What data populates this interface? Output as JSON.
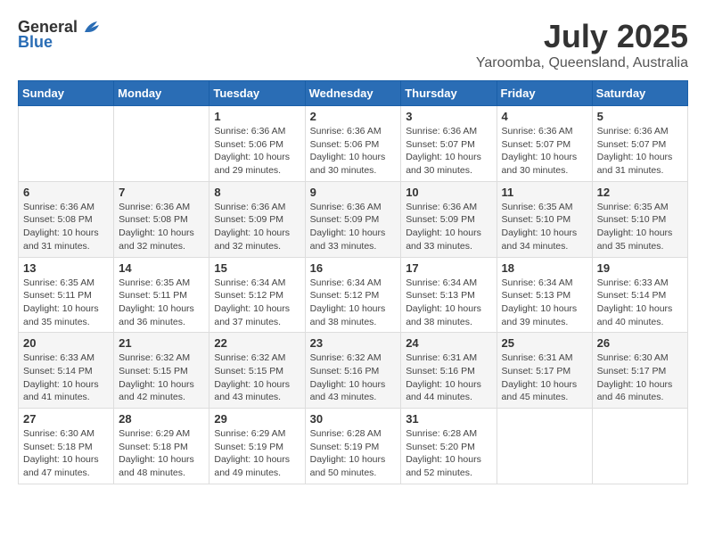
{
  "header": {
    "logo_general": "General",
    "logo_blue": "Blue",
    "month": "July 2025",
    "location": "Yaroomba, Queensland, Australia"
  },
  "calendar": {
    "days_of_week": [
      "Sunday",
      "Monday",
      "Tuesday",
      "Wednesday",
      "Thursday",
      "Friday",
      "Saturday"
    ],
    "weeks": [
      [
        {
          "day": "",
          "info": ""
        },
        {
          "day": "",
          "info": ""
        },
        {
          "day": "1",
          "info": "Sunrise: 6:36 AM\nSunset: 5:06 PM\nDaylight: 10 hours\nand 29 minutes."
        },
        {
          "day": "2",
          "info": "Sunrise: 6:36 AM\nSunset: 5:06 PM\nDaylight: 10 hours\nand 30 minutes."
        },
        {
          "day": "3",
          "info": "Sunrise: 6:36 AM\nSunset: 5:07 PM\nDaylight: 10 hours\nand 30 minutes."
        },
        {
          "day": "4",
          "info": "Sunrise: 6:36 AM\nSunset: 5:07 PM\nDaylight: 10 hours\nand 30 minutes."
        },
        {
          "day": "5",
          "info": "Sunrise: 6:36 AM\nSunset: 5:07 PM\nDaylight: 10 hours\nand 31 minutes."
        }
      ],
      [
        {
          "day": "6",
          "info": "Sunrise: 6:36 AM\nSunset: 5:08 PM\nDaylight: 10 hours\nand 31 minutes."
        },
        {
          "day": "7",
          "info": "Sunrise: 6:36 AM\nSunset: 5:08 PM\nDaylight: 10 hours\nand 32 minutes."
        },
        {
          "day": "8",
          "info": "Sunrise: 6:36 AM\nSunset: 5:09 PM\nDaylight: 10 hours\nand 32 minutes."
        },
        {
          "day": "9",
          "info": "Sunrise: 6:36 AM\nSunset: 5:09 PM\nDaylight: 10 hours\nand 33 minutes."
        },
        {
          "day": "10",
          "info": "Sunrise: 6:36 AM\nSunset: 5:09 PM\nDaylight: 10 hours\nand 33 minutes."
        },
        {
          "day": "11",
          "info": "Sunrise: 6:35 AM\nSunset: 5:10 PM\nDaylight: 10 hours\nand 34 minutes."
        },
        {
          "day": "12",
          "info": "Sunrise: 6:35 AM\nSunset: 5:10 PM\nDaylight: 10 hours\nand 35 minutes."
        }
      ],
      [
        {
          "day": "13",
          "info": "Sunrise: 6:35 AM\nSunset: 5:11 PM\nDaylight: 10 hours\nand 35 minutes."
        },
        {
          "day": "14",
          "info": "Sunrise: 6:35 AM\nSunset: 5:11 PM\nDaylight: 10 hours\nand 36 minutes."
        },
        {
          "day": "15",
          "info": "Sunrise: 6:34 AM\nSunset: 5:12 PM\nDaylight: 10 hours\nand 37 minutes."
        },
        {
          "day": "16",
          "info": "Sunrise: 6:34 AM\nSunset: 5:12 PM\nDaylight: 10 hours\nand 38 minutes."
        },
        {
          "day": "17",
          "info": "Sunrise: 6:34 AM\nSunset: 5:13 PM\nDaylight: 10 hours\nand 38 minutes."
        },
        {
          "day": "18",
          "info": "Sunrise: 6:34 AM\nSunset: 5:13 PM\nDaylight: 10 hours\nand 39 minutes."
        },
        {
          "day": "19",
          "info": "Sunrise: 6:33 AM\nSunset: 5:14 PM\nDaylight: 10 hours\nand 40 minutes."
        }
      ],
      [
        {
          "day": "20",
          "info": "Sunrise: 6:33 AM\nSunset: 5:14 PM\nDaylight: 10 hours\nand 41 minutes."
        },
        {
          "day": "21",
          "info": "Sunrise: 6:32 AM\nSunset: 5:15 PM\nDaylight: 10 hours\nand 42 minutes."
        },
        {
          "day": "22",
          "info": "Sunrise: 6:32 AM\nSunset: 5:15 PM\nDaylight: 10 hours\nand 43 minutes."
        },
        {
          "day": "23",
          "info": "Sunrise: 6:32 AM\nSunset: 5:16 PM\nDaylight: 10 hours\nand 43 minutes."
        },
        {
          "day": "24",
          "info": "Sunrise: 6:31 AM\nSunset: 5:16 PM\nDaylight: 10 hours\nand 44 minutes."
        },
        {
          "day": "25",
          "info": "Sunrise: 6:31 AM\nSunset: 5:17 PM\nDaylight: 10 hours\nand 45 minutes."
        },
        {
          "day": "26",
          "info": "Sunrise: 6:30 AM\nSunset: 5:17 PM\nDaylight: 10 hours\nand 46 minutes."
        }
      ],
      [
        {
          "day": "27",
          "info": "Sunrise: 6:30 AM\nSunset: 5:18 PM\nDaylight: 10 hours\nand 47 minutes."
        },
        {
          "day": "28",
          "info": "Sunrise: 6:29 AM\nSunset: 5:18 PM\nDaylight: 10 hours\nand 48 minutes."
        },
        {
          "day": "29",
          "info": "Sunrise: 6:29 AM\nSunset: 5:19 PM\nDaylight: 10 hours\nand 49 minutes."
        },
        {
          "day": "30",
          "info": "Sunrise: 6:28 AM\nSunset: 5:19 PM\nDaylight: 10 hours\nand 50 minutes."
        },
        {
          "day": "31",
          "info": "Sunrise: 6:28 AM\nSunset: 5:20 PM\nDaylight: 10 hours\nand 52 minutes."
        },
        {
          "day": "",
          "info": ""
        },
        {
          "day": "",
          "info": ""
        }
      ]
    ]
  }
}
